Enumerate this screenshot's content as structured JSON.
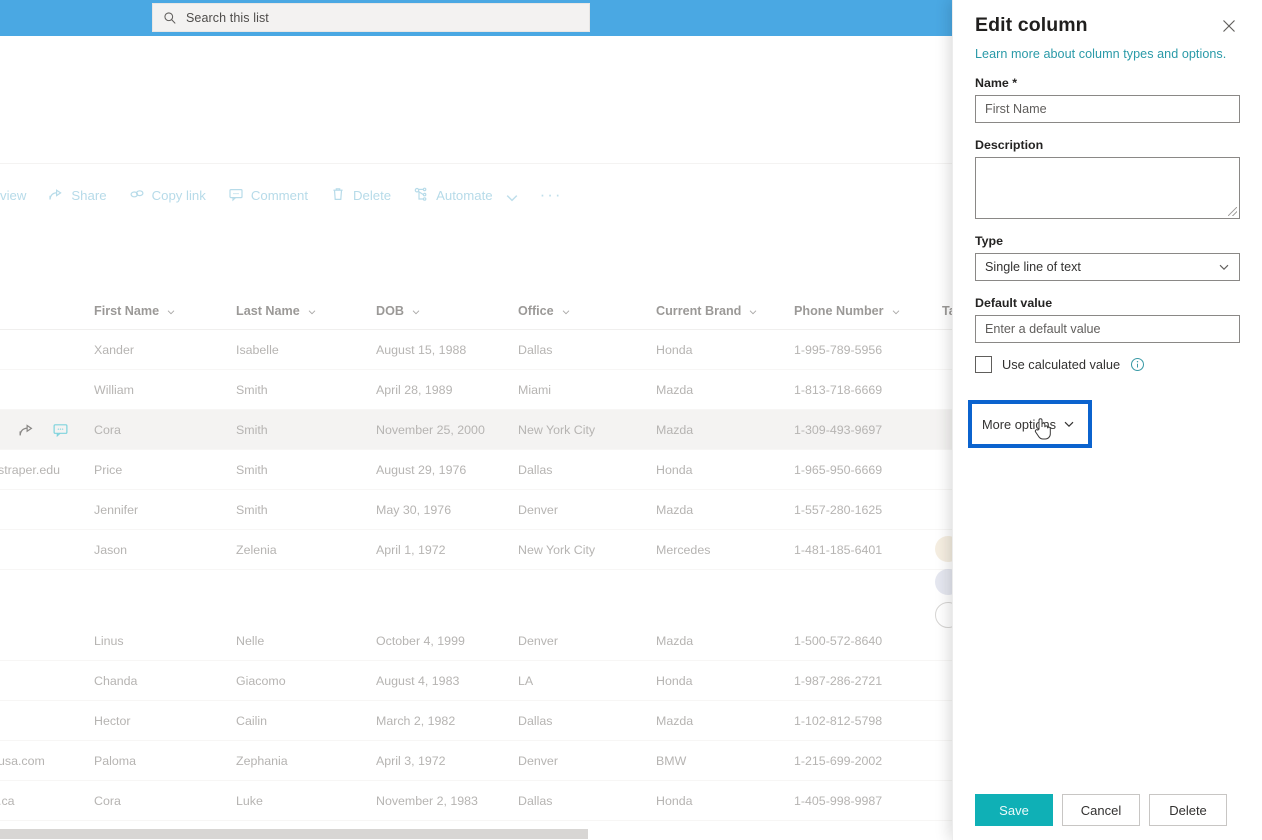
{
  "header": {
    "search": {
      "placeholder": "Search this list",
      "icon": "search-icon"
    },
    "bar_color": "#4aa8e3"
  },
  "toolbar": {
    "items": [
      {
        "label": "view",
        "icon": "eye-icon",
        "truncated": true
      },
      {
        "label": "Share",
        "icon": "share-icon"
      },
      {
        "label": "Copy link",
        "icon": "link-icon"
      },
      {
        "label": "Comment",
        "icon": "comment-icon"
      },
      {
        "label": "Delete",
        "icon": "trash-icon"
      },
      {
        "label": "Automate",
        "icon": "automate-icon",
        "has_chevron": true
      }
    ],
    "overflow_label": "···"
  },
  "table": {
    "columns": [
      {
        "label": "First Name",
        "sortable": true
      },
      {
        "label": "Last Name",
        "sortable": true
      },
      {
        "label": "DOB",
        "sortable": true
      },
      {
        "label": "Office",
        "sortable": true
      },
      {
        "label": "Current Brand",
        "sortable": true
      },
      {
        "label": "Phone Number",
        "sortable": true
      },
      {
        "label": "Ta",
        "sortable": false,
        "truncated": true
      }
    ],
    "rows": [
      {
        "first": "Xander",
        "last": "Isabelle",
        "dob": "August 15, 1988",
        "office": "Dallas",
        "brand": "Honda",
        "phone": "1-995-789-5956",
        "selected": false,
        "email_fragment": ""
      },
      {
        "first": "William",
        "last": "Smith",
        "dob": "April 28, 1989",
        "office": "Miami",
        "brand": "Mazda",
        "phone": "1-813-718-6669",
        "selected": false,
        "email_fragment": ""
      },
      {
        "first": "Cora",
        "last": "Smith",
        "dob": "November 25, 2000",
        "office": "New York City",
        "brand": "Mazda",
        "phone": "1-309-493-9697",
        "selected": true,
        "email_fragment": ""
      },
      {
        "first": "Price",
        "last": "Smith",
        "dob": "August 29, 1976",
        "office": "Dallas",
        "brand": "Honda",
        "phone": "1-965-950-6669",
        "selected": false,
        "email_fragment": "straper.edu"
      },
      {
        "first": "Jennifer",
        "last": "Smith",
        "dob": "May 30, 1976",
        "office": "Denver",
        "brand": "Mazda",
        "phone": "1-557-280-1625",
        "selected": false,
        "email_fragment": ""
      },
      {
        "first": "Jason",
        "last": "Zelenia",
        "dob": "April 1, 1972",
        "office": "New York City",
        "brand": "Mercedes",
        "phone": "1-481-185-6401",
        "selected": false,
        "email_fragment": ""
      },
      {
        "first": "Linus",
        "last": "Nelle",
        "dob": "October 4, 1999",
        "office": "Denver",
        "brand": "Mazda",
        "phone": "1-500-572-8640",
        "selected": false,
        "email_fragment": ""
      },
      {
        "first": "Chanda",
        "last": "Giacomo",
        "dob": "August 4, 1983",
        "office": "LA",
        "brand": "Honda",
        "phone": "1-987-286-2721",
        "selected": false,
        "email_fragment": ""
      },
      {
        "first": "Hector",
        "last": "Cailin",
        "dob": "March 2, 1982",
        "office": "Dallas",
        "brand": "Mazda",
        "phone": "1-102-812-5798",
        "selected": false,
        "email_fragment": ""
      },
      {
        "first": "Paloma",
        "last": "Zephania",
        "dob": "April 3, 1972",
        "office": "Denver",
        "brand": "BMW",
        "phone": "1-215-699-2002",
        "selected": false,
        "email_fragment": "usa.com"
      },
      {
        "first": "Cora",
        "last": "Luke",
        "dob": "November 2, 1983",
        "office": "Dallas",
        "brand": "Honda",
        "phone": "1-405-998-9987",
        "selected": false,
        "email_fragment": ".ca"
      }
    ],
    "selected_row_icons": [
      {
        "name": "share-icon"
      },
      {
        "name": "comment-icon"
      }
    ]
  },
  "panel": {
    "title": "Edit column",
    "close_icon": "close-icon",
    "learn_more": "Learn more about column types and options.",
    "name": {
      "label": "Name *",
      "value": "First Name"
    },
    "description": {
      "label": "Description",
      "value": ""
    },
    "type": {
      "label": "Type",
      "value": "Single line of text"
    },
    "default_value": {
      "label": "Default value",
      "placeholder": "Enter a default value",
      "value": ""
    },
    "calculated": {
      "label": "Use calculated value",
      "checked": false,
      "info_icon": "info-icon"
    },
    "more_options": {
      "label": "More options",
      "expanded": false,
      "focused": true
    },
    "actions": {
      "save": "Save",
      "cancel": "Cancel",
      "delete": "Delete"
    },
    "accent_color": "#0fb0b6",
    "link_color": "#2a9aa8",
    "focus_ring_color": "#0b63ce"
  }
}
